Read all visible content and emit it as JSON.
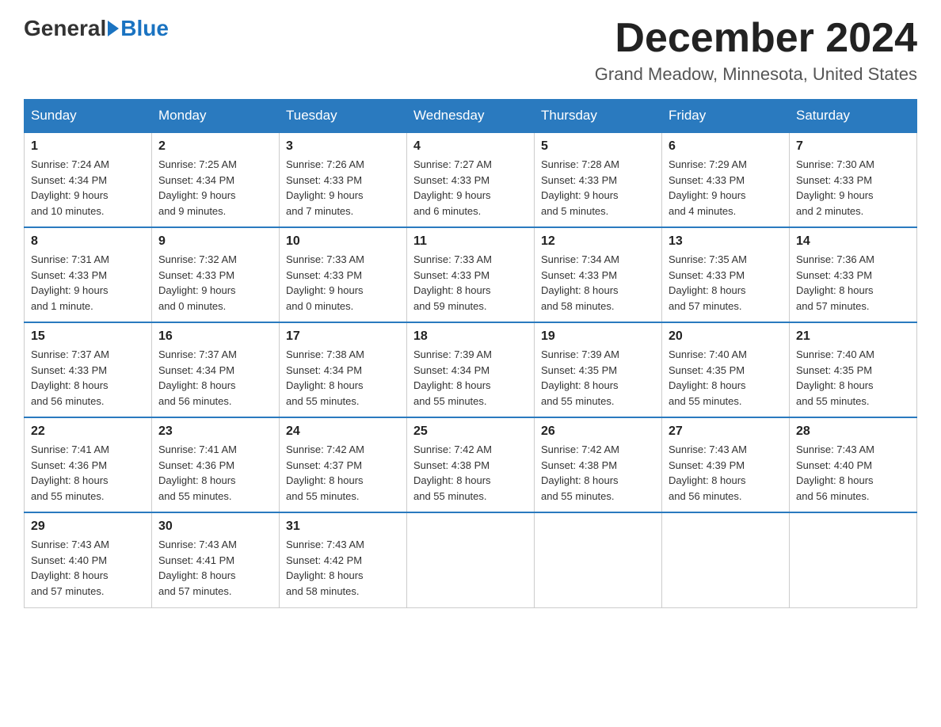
{
  "logo": {
    "general": "General",
    "blue": "Blue"
  },
  "title": "December 2024",
  "location": "Grand Meadow, Minnesota, United States",
  "days_of_week": [
    "Sunday",
    "Monday",
    "Tuesday",
    "Wednesday",
    "Thursday",
    "Friday",
    "Saturday"
  ],
  "weeks": [
    [
      {
        "day": "1",
        "sunrise": "7:24 AM",
        "sunset": "4:34 PM",
        "daylight": "9 hours and 10 minutes."
      },
      {
        "day": "2",
        "sunrise": "7:25 AM",
        "sunset": "4:34 PM",
        "daylight": "9 hours and 9 minutes."
      },
      {
        "day": "3",
        "sunrise": "7:26 AM",
        "sunset": "4:33 PM",
        "daylight": "9 hours and 7 minutes."
      },
      {
        "day": "4",
        "sunrise": "7:27 AM",
        "sunset": "4:33 PM",
        "daylight": "9 hours and 6 minutes."
      },
      {
        "day": "5",
        "sunrise": "7:28 AM",
        "sunset": "4:33 PM",
        "daylight": "9 hours and 5 minutes."
      },
      {
        "day": "6",
        "sunrise": "7:29 AM",
        "sunset": "4:33 PM",
        "daylight": "9 hours and 4 minutes."
      },
      {
        "day": "7",
        "sunrise": "7:30 AM",
        "sunset": "4:33 PM",
        "daylight": "9 hours and 2 minutes."
      }
    ],
    [
      {
        "day": "8",
        "sunrise": "7:31 AM",
        "sunset": "4:33 PM",
        "daylight": "9 hours and 1 minute."
      },
      {
        "day": "9",
        "sunrise": "7:32 AM",
        "sunset": "4:33 PM",
        "daylight": "9 hours and 0 minutes."
      },
      {
        "day": "10",
        "sunrise": "7:33 AM",
        "sunset": "4:33 PM",
        "daylight": "9 hours and 0 minutes."
      },
      {
        "day": "11",
        "sunrise": "7:33 AM",
        "sunset": "4:33 PM",
        "daylight": "8 hours and 59 minutes."
      },
      {
        "day": "12",
        "sunrise": "7:34 AM",
        "sunset": "4:33 PM",
        "daylight": "8 hours and 58 minutes."
      },
      {
        "day": "13",
        "sunrise": "7:35 AM",
        "sunset": "4:33 PM",
        "daylight": "8 hours and 57 minutes."
      },
      {
        "day": "14",
        "sunrise": "7:36 AM",
        "sunset": "4:33 PM",
        "daylight": "8 hours and 57 minutes."
      }
    ],
    [
      {
        "day": "15",
        "sunrise": "7:37 AM",
        "sunset": "4:33 PM",
        "daylight": "8 hours and 56 minutes."
      },
      {
        "day": "16",
        "sunrise": "7:37 AM",
        "sunset": "4:34 PM",
        "daylight": "8 hours and 56 minutes."
      },
      {
        "day": "17",
        "sunrise": "7:38 AM",
        "sunset": "4:34 PM",
        "daylight": "8 hours and 55 minutes."
      },
      {
        "day": "18",
        "sunrise": "7:39 AM",
        "sunset": "4:34 PM",
        "daylight": "8 hours and 55 minutes."
      },
      {
        "day": "19",
        "sunrise": "7:39 AM",
        "sunset": "4:35 PM",
        "daylight": "8 hours and 55 minutes."
      },
      {
        "day": "20",
        "sunrise": "7:40 AM",
        "sunset": "4:35 PM",
        "daylight": "8 hours and 55 minutes."
      },
      {
        "day": "21",
        "sunrise": "7:40 AM",
        "sunset": "4:35 PM",
        "daylight": "8 hours and 55 minutes."
      }
    ],
    [
      {
        "day": "22",
        "sunrise": "7:41 AM",
        "sunset": "4:36 PM",
        "daylight": "8 hours and 55 minutes."
      },
      {
        "day": "23",
        "sunrise": "7:41 AM",
        "sunset": "4:36 PM",
        "daylight": "8 hours and 55 minutes."
      },
      {
        "day": "24",
        "sunrise": "7:42 AM",
        "sunset": "4:37 PM",
        "daylight": "8 hours and 55 minutes."
      },
      {
        "day": "25",
        "sunrise": "7:42 AM",
        "sunset": "4:38 PM",
        "daylight": "8 hours and 55 minutes."
      },
      {
        "day": "26",
        "sunrise": "7:42 AM",
        "sunset": "4:38 PM",
        "daylight": "8 hours and 55 minutes."
      },
      {
        "day": "27",
        "sunrise": "7:43 AM",
        "sunset": "4:39 PM",
        "daylight": "8 hours and 56 minutes."
      },
      {
        "day": "28",
        "sunrise": "7:43 AM",
        "sunset": "4:40 PM",
        "daylight": "8 hours and 56 minutes."
      }
    ],
    [
      {
        "day": "29",
        "sunrise": "7:43 AM",
        "sunset": "4:40 PM",
        "daylight": "8 hours and 57 minutes."
      },
      {
        "day": "30",
        "sunrise": "7:43 AM",
        "sunset": "4:41 PM",
        "daylight": "8 hours and 57 minutes."
      },
      {
        "day": "31",
        "sunrise": "7:43 AM",
        "sunset": "4:42 PM",
        "daylight": "8 hours and 58 minutes."
      },
      null,
      null,
      null,
      null
    ]
  ],
  "labels": {
    "sunrise": "Sunrise:",
    "sunset": "Sunset:",
    "daylight": "Daylight:"
  }
}
